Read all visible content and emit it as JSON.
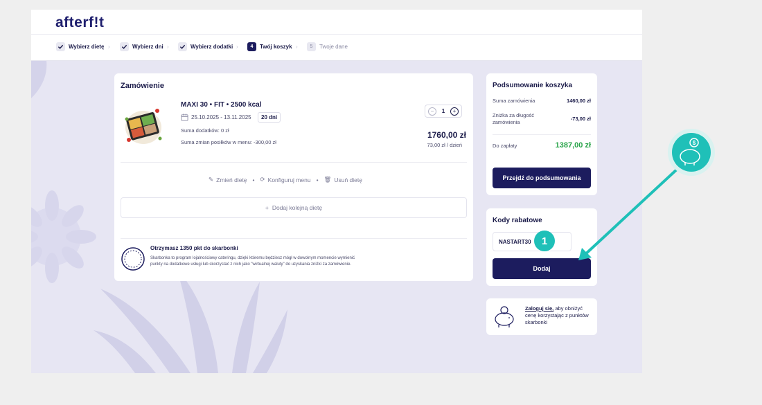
{
  "brand": {
    "logo": "afterf!t"
  },
  "steps": [
    {
      "num": "",
      "label": "Wybierz dietę",
      "state": "done"
    },
    {
      "num": "",
      "label": "Wybierz dni",
      "state": "done"
    },
    {
      "num": "",
      "label": "Wybierz dodatki",
      "state": "done"
    },
    {
      "num": "4",
      "label": "Twój koszyk",
      "state": "active"
    },
    {
      "num": "5",
      "label": "Twoje dane",
      "state": "pending"
    }
  ],
  "order": {
    "title": "Zamówienie",
    "diet_name": "MAXI 30 • FIT • 2500 kcal",
    "date_range": "25.10.2025 - 13.11.2025",
    "days_badge": "20 dni",
    "addons_sum": "Suma dodatków: 0 zł",
    "menu_changes_sum": "Suma zmian posiłków w menu: -300,00 zł",
    "quantity": "1",
    "price": "1760,00 zł",
    "price_per_day": "73,00 zł / dzień",
    "actions": {
      "change": "Zmień dietę",
      "configure": "Konfiguruj menu",
      "remove": "Usuń dietę"
    },
    "add_diet": "Dodaj kolejną dietę",
    "points_title": "Otrzymasz 1350 pkt do skarbonki",
    "points_desc": "Skarbonka to program lojalnościowy cateringu, dzięki któremu będziesz mógł w dowolnym momencie wymienić punkty na dodatkowe usługi lub skorzystać z nich jako \"wirtualnej waluty\" do uzyskania zniżki za zamówienie."
  },
  "summary": {
    "title": "Podsumowanie koszyka",
    "order_sum_label": "Suma zamówienia",
    "order_sum_value": "1460,00 zł",
    "discount_label": "Zniżka za długość zamówienia",
    "discount_value": "-73,00 zł",
    "to_pay_label": "Do zapłaty",
    "to_pay_value": "1387,00 zł",
    "checkout_button": "Przejdź do podsumowania"
  },
  "promo": {
    "title": "Kody rabatowe",
    "code_value": "NASTART30",
    "add_button": "Dodaj",
    "callout_number": "1"
  },
  "login": {
    "link": "Zaloguj się,",
    "text": " aby obniżyć cenę korzystając z punktów skarbonki"
  },
  "colors": {
    "navy": "#1c1c5e",
    "green": "#27a348",
    "teal": "#1fc0b8",
    "bg": "#e7e6f3"
  }
}
